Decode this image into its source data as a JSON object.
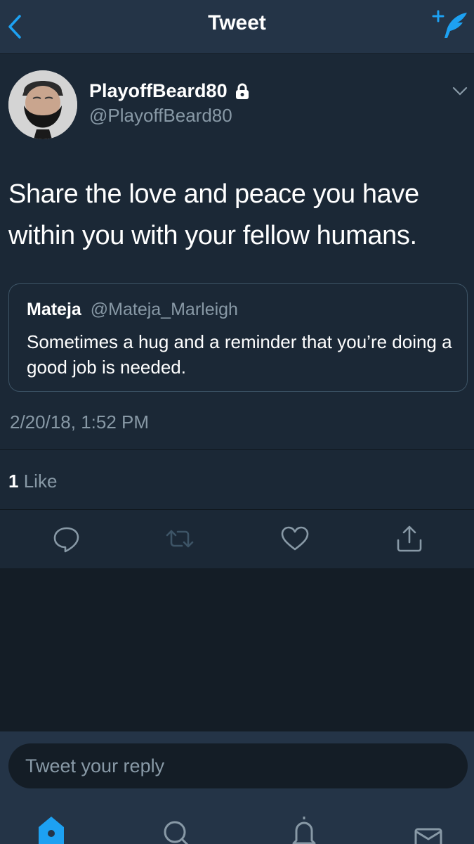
{
  "header": {
    "title": "Tweet"
  },
  "tweet": {
    "display_name": "PlayoffBeard80",
    "handle": "@PlayoffBeard80",
    "text": "Share the love and peace you have within you with your fellow humans.",
    "quoted": {
      "display_name": "Mateja",
      "handle": "@Mateja_Marleigh",
      "text": "Sometimes a hug and a reminder that you’re doing a good job is needed."
    },
    "timestamp": "2/20/18, 1:52 PM",
    "likes": {
      "count": "1",
      "label": "Like"
    }
  },
  "icons": {
    "back": "chevron-left-icon",
    "compose": "compose-quill-icon",
    "lock": "lock-icon",
    "more": "chevron-down-icon",
    "reply": "reply-bubble-icon",
    "retweet": "retweet-icon",
    "like": "heart-icon",
    "share": "share-icon",
    "home": "home-icon",
    "search": "search-icon",
    "notifications": "bell-icon",
    "messages": "envelope-icon"
  },
  "reply": {
    "placeholder": "Tweet your reply"
  },
  "colors": {
    "accent": "#1da1f2",
    "header_bg": "#243447",
    "tweet_bg": "#1b2836",
    "page_bg": "#141d26",
    "secondary_text": "#8899a6",
    "icon_gray": "#8899a6",
    "retweet_disabled": "#3d5466"
  }
}
